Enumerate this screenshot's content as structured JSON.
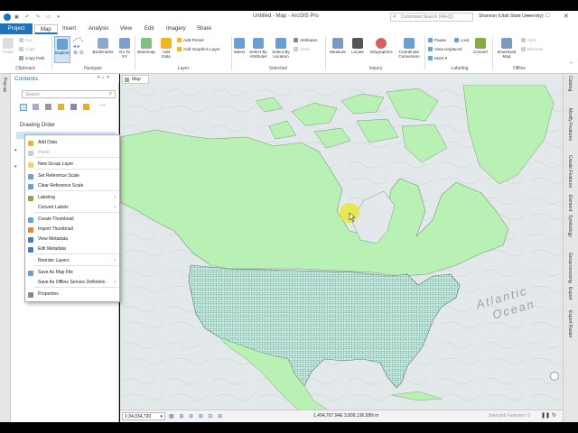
{
  "titlebar": {
    "title": "Untitled - Map - ArcGIS Pro",
    "search_placeholder": "Command Search (Alt+Q)",
    "user": "Shannon (Utah State University)"
  },
  "tabs": [
    "Project",
    "Map",
    "Insert",
    "Analysis",
    "View",
    "Edit",
    "Imagery",
    "Share"
  ],
  "ribbon": {
    "clipboard": {
      "paste": "Paste",
      "cut": "Cut",
      "copy": "Copy",
      "copy_path": "Copy Path",
      "label": "Clipboard"
    },
    "navigate": {
      "explore": "Explore",
      "bookmarks": "Bookmarks",
      "goto": "Go To XY",
      "label": "Navigate"
    },
    "layer": {
      "basemap": "Basemap",
      "add_data": "Add Data",
      "add_preset": "Add Preset",
      "add_graphics": "Add Graphics Layer",
      "label": "Layer"
    },
    "selection": {
      "select": "Select",
      "by_attr": "Select By Attributes",
      "by_loc": "Select By Location",
      "attributes": "Attributes",
      "clear": "Clear",
      "label": "Selection"
    },
    "inquiry": {
      "measure": "Measure",
      "locate": "Locate",
      "infographics": "Infographics",
      "coordinate": "Coordinate Conversion",
      "label": "Inquiry"
    },
    "labeling": {
      "pause": "Pause",
      "lock": "Lock",
      "view_unplaced": "View Unplaced",
      "more": "More",
      "convert": "Convert",
      "label": "Labeling"
    },
    "offline": {
      "download": "Download Map",
      "sync": "Sync",
      "remove": "Remove",
      "label": "Offline"
    }
  },
  "contents": {
    "title": "Contents",
    "search_placeholder": "Search",
    "drawing_order": "Drawing Order"
  },
  "left_strip": "Pop-up",
  "map_tab": "Map",
  "context_menu": [
    {
      "label": "Add Data",
      "icon": "add-data-icon",
      "color": "#f0b429",
      "disabled": false
    },
    {
      "label": "Paste",
      "icon": "paste-icon",
      "color": "#cccccc",
      "disabled": true
    },
    {
      "label": "New Group Layer",
      "icon": "group-layer-icon",
      "color": "#f6d365",
      "disabled": false
    },
    {
      "label": "Set Reference Scale",
      "icon": "reference-scale-icon",
      "color": "#6a9fd4",
      "disabled": false
    },
    {
      "label": "Clear Reference Scale",
      "icon": "clear-scale-icon",
      "color": "#6a9fd4",
      "disabled": false
    },
    {
      "label": "Labeling",
      "icon": "labeling-icon",
      "color": "#88aa44",
      "disabled": false,
      "submenu": true
    },
    {
      "label": "Convert Labels",
      "icon": "",
      "color": "",
      "disabled": false,
      "submenu": true
    },
    {
      "label": "Create Thumbnail",
      "icon": "thumbnail-icon",
      "color": "#6a9fd4",
      "disabled": false
    },
    {
      "label": "Import Thumbnail",
      "icon": "import-icon",
      "color": "#e08a2e",
      "disabled": false
    },
    {
      "label": "View Metadata",
      "icon": "metadata-icon",
      "color": "#4a7cc0",
      "disabled": false
    },
    {
      "label": "Edit Metadata",
      "icon": "edit-metadata-icon",
      "color": "#4a7cc0",
      "disabled": false
    },
    {
      "label": "Reorder Layers",
      "icon": "",
      "color": "",
      "disabled": false,
      "submenu": true
    },
    {
      "label": "Save As Map File",
      "icon": "save-icon",
      "color": "#6a9fd4",
      "disabled": false
    },
    {
      "label": "Save As Offline Service Definition",
      "icon": "",
      "color": "",
      "disabled": false,
      "submenu": true
    },
    {
      "label": "Properties",
      "icon": "properties-icon",
      "color": "#888888",
      "disabled": false
    }
  ],
  "right_strip": [
    "Catalog",
    "Modify Features",
    "Create Features",
    "Element",
    "Symbology",
    "Geoprocessing",
    "Export",
    "Export Raster"
  ],
  "map": {
    "ocean_line1": "Atlantic",
    "ocean_line2": "Ocean",
    "land_color": "#b9f0b4",
    "county_color": "#c8f5e6"
  },
  "status": {
    "scale": "1:34,034,720",
    "coords": "1,404,767.94E 3,809,136.58N m",
    "selected": "Selected Features: 0"
  },
  "colors": {
    "accent": "#1f73b8",
    "highlight": "#e8e83a"
  }
}
